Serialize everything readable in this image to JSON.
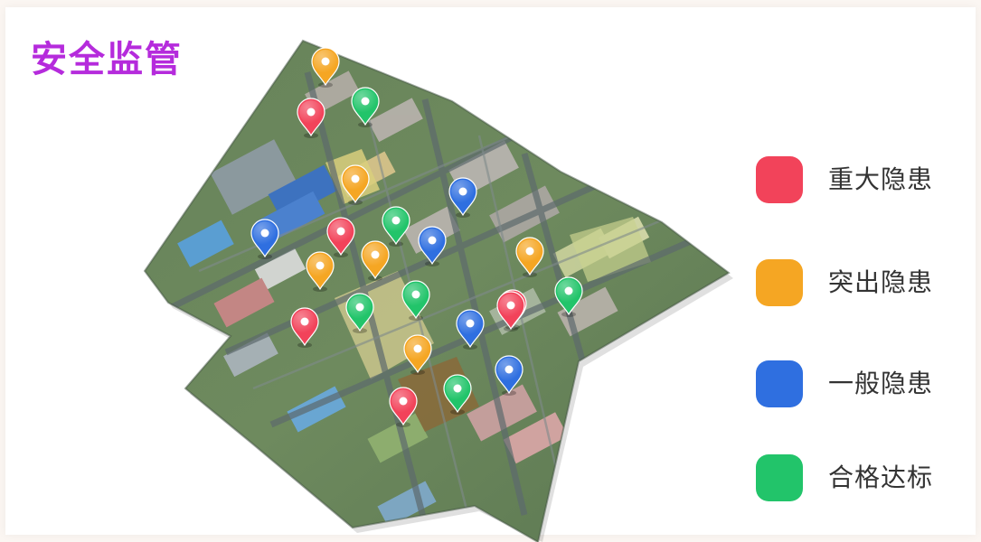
{
  "title": "安全监管",
  "colors": {
    "title": "#b52bdc",
    "major": "#f2435a",
    "prominent": "#f5a623",
    "general": "#2f6fe0",
    "qualified": "#22c46a"
  },
  "legend": [
    {
      "label": "重大隐患",
      "color": "#f2435a"
    },
    {
      "label": "突出隐患",
      "color": "#f5a623"
    },
    {
      "label": "一般隐患",
      "color": "#2f6fe0"
    },
    {
      "label": "合格达标",
      "color": "#22c46a"
    }
  ],
  "map": {
    "marker_counts": {
      "重大隐患": 6,
      "突出隐患": 7,
      "一般隐患": 6,
      "合格达标": 7
    },
    "markers_icon": "map-pin-icon"
  }
}
